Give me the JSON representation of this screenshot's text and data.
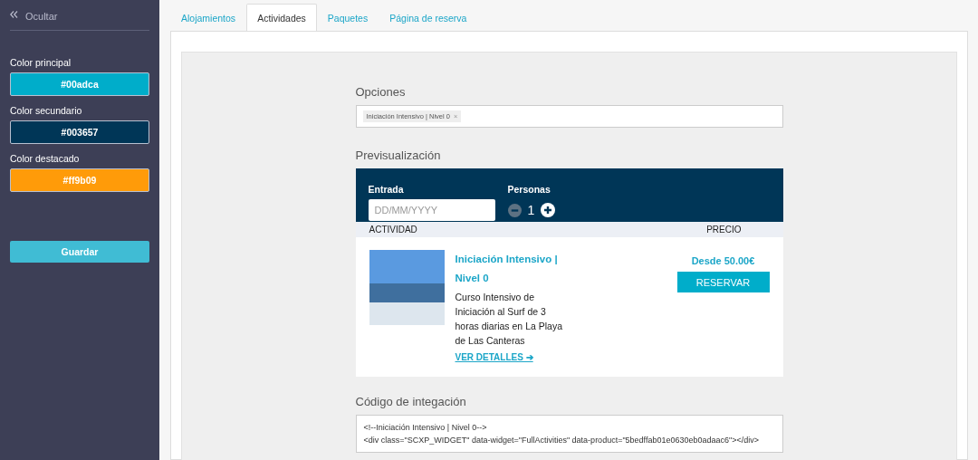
{
  "sidebar": {
    "hide_label": "Ocultar",
    "colors": [
      {
        "label": "Color principal",
        "value": "#00adca",
        "color": "#00adca"
      },
      {
        "label": "Color secundario",
        "value": "#003657",
        "color": "#003657"
      },
      {
        "label": "Color destacado",
        "value": "#ff9b09",
        "color": "#ff9b09"
      }
    ],
    "save_button": "Guardar"
  },
  "tabs": [
    {
      "label": "Alojamientos",
      "selected": false
    },
    {
      "label": "Actividades",
      "selected": true
    },
    {
      "label": "Paquetes",
      "selected": false
    },
    {
      "label": "Página de reserva",
      "selected": false
    }
  ],
  "options": {
    "title": "Opciones",
    "tags": [
      {
        "label": "Iniciación Intensivo | Nivel 0",
        "remove": "×"
      }
    ]
  },
  "preview": {
    "title": "Previsualización",
    "date_label": "Entrada",
    "date_placeholder": "DD/MM/YYYY",
    "people_label": "Personas",
    "people_count": "1",
    "columns": [
      "ACTIVIDAD",
      "PRECIO"
    ],
    "activity": {
      "name": "Iniciación Intensivo | Nivel 0",
      "description": "Curso Intensivo de Iniciación al Surf de 3 horas diarias en La Playa de Las Canteras",
      "details_link": "VER DETALLES ➔",
      "price": "Desde 50.00€",
      "book_button": "RESERVAR"
    }
  },
  "code": {
    "title": "Código de integación",
    "lines": [
      "<!--Iniciación Intensivo | Nivel 0-->",
      "<div class=\"SCXP_WIDGET\" data-widget=\"FullActivities\" data-product=\"5bedffab01e0630eb0adaac6\"></div>"
    ]
  }
}
